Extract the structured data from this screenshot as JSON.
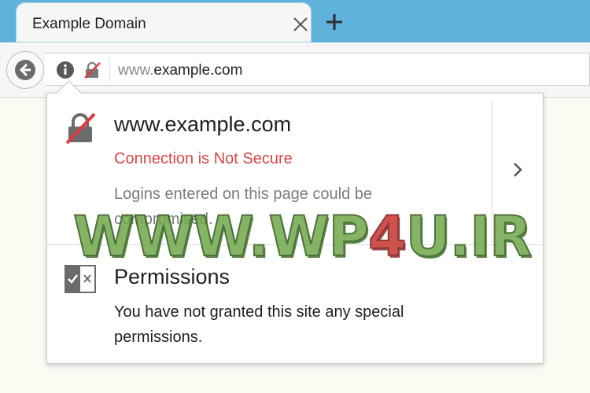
{
  "tab": {
    "title": "Example Domain",
    "close_icon": "close-icon",
    "new_tab_icon": "plus-icon"
  },
  "navbar": {
    "back_icon": "arrow-left-icon",
    "info_icon": "info-icon",
    "lock_icon": "insecure-lock-icon",
    "url_prefix": "www.",
    "url_host": "example.com"
  },
  "panel": {
    "site": "www.example.com",
    "status": "Connection is Not Secure",
    "description": "Logins entered on this page could be compromised.",
    "more_icon": "chevron-right-icon",
    "permissions_title": "Permissions",
    "permissions_desc": "You have not granted this site any special permissions."
  },
  "watermark": {
    "part1": "WWW.WP",
    "part2": "4",
    "part3": "U.IR"
  },
  "colors": {
    "tab_strip": "#5fb3da",
    "danger": "#d9454a",
    "page_bg": "#fbfaf3"
  }
}
